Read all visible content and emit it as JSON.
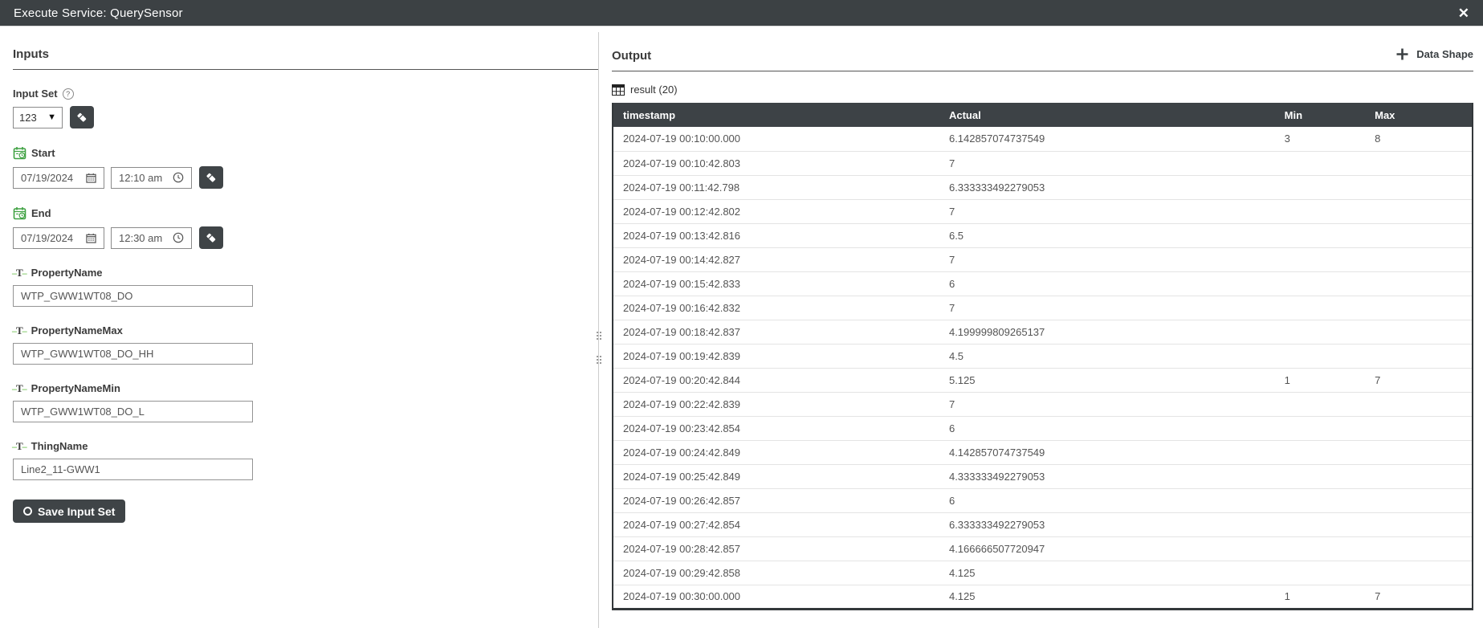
{
  "titlebar": {
    "title": "Execute Service: QuerySensor"
  },
  "icons": {
    "close": "✕",
    "help": "?",
    "dropdown_arrow": "▼"
  },
  "colors": {
    "titlebar_bg": "#3c4144",
    "table_header_bg": "#3d4246",
    "button_bg": "#3f4447",
    "accent_green": "#3fa142",
    "row_border": "#e4e4e4"
  },
  "inputs": {
    "heading": "Inputs",
    "input_set": {
      "label": "Input Set",
      "value": "123"
    },
    "start": {
      "label": "Start",
      "date": "07/19/2024",
      "time": "12:10 am"
    },
    "end": {
      "label": "End",
      "date": "07/19/2024",
      "time": "12:30 am"
    },
    "fields": [
      {
        "label": "PropertyName",
        "value": "WTP_GWW1WT08_DO"
      },
      {
        "label": "PropertyNameMax",
        "value": "WTP_GWW1WT08_DO_HH"
      },
      {
        "label": "PropertyNameMin",
        "value": "WTP_GWW1WT08_DO_L"
      },
      {
        "label": "ThingName",
        "value": "Line2_11-GWW1"
      }
    ],
    "save_button_label": "Save Input Set"
  },
  "output": {
    "heading": "Output",
    "data_shape_button_label": "Data Shape",
    "result_label": "result (20)",
    "table": {
      "columns": [
        "timestamp",
        "Actual",
        "Min",
        "Max"
      ],
      "rows": [
        [
          "2024-07-19 00:10:00.000",
          "6.142857074737549",
          "3",
          "8"
        ],
        [
          "2024-07-19 00:10:42.803",
          "7",
          "",
          ""
        ],
        [
          "2024-07-19 00:11:42.798",
          "6.333333492279053",
          "",
          ""
        ],
        [
          "2024-07-19 00:12:42.802",
          "7",
          "",
          ""
        ],
        [
          "2024-07-19 00:13:42.816",
          "6.5",
          "",
          ""
        ],
        [
          "2024-07-19 00:14:42.827",
          "7",
          "",
          ""
        ],
        [
          "2024-07-19 00:15:42.833",
          "6",
          "",
          ""
        ],
        [
          "2024-07-19 00:16:42.832",
          "7",
          "",
          ""
        ],
        [
          "2024-07-19 00:18:42.837",
          "4.199999809265137",
          "",
          ""
        ],
        [
          "2024-07-19 00:19:42.839",
          "4.5",
          "",
          ""
        ],
        [
          "2024-07-19 00:20:42.844",
          "5.125",
          "1",
          "7"
        ],
        [
          "2024-07-19 00:22:42.839",
          "7",
          "",
          ""
        ],
        [
          "2024-07-19 00:23:42.854",
          "6",
          "",
          ""
        ],
        [
          "2024-07-19 00:24:42.849",
          "4.142857074737549",
          "",
          ""
        ],
        [
          "2024-07-19 00:25:42.849",
          "4.333333492279053",
          "",
          ""
        ],
        [
          "2024-07-19 00:26:42.857",
          "6",
          "",
          ""
        ],
        [
          "2024-07-19 00:27:42.854",
          "6.333333492279053",
          "",
          ""
        ],
        [
          "2024-07-19 00:28:42.857",
          "4.166666507720947",
          "",
          ""
        ],
        [
          "2024-07-19 00:29:42.858",
          "4.125",
          "",
          ""
        ],
        [
          "2024-07-19 00:30:00.000",
          "4.125",
          "1",
          "7"
        ]
      ]
    }
  }
}
